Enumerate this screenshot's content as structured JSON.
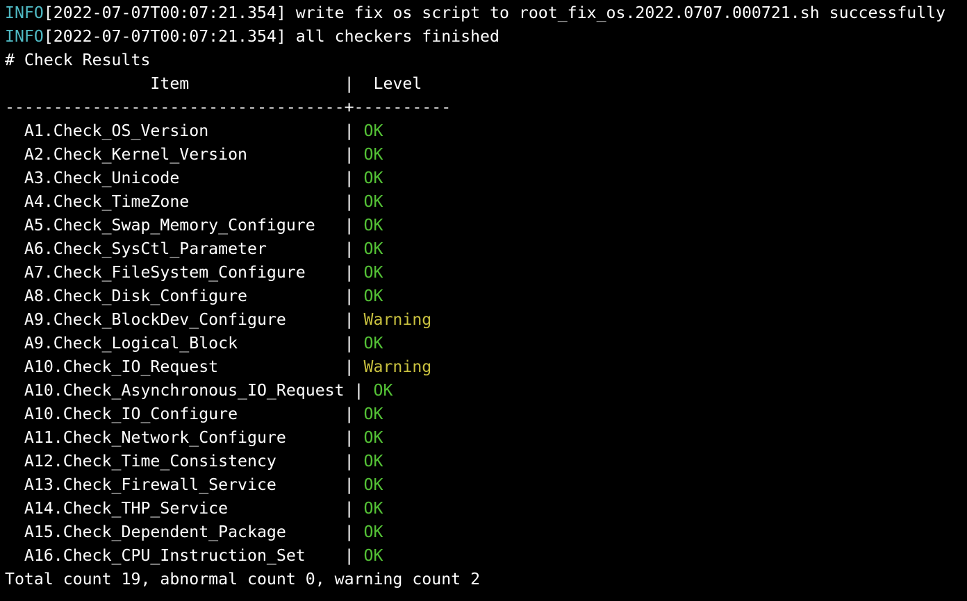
{
  "colors": {
    "background": "#000000",
    "text": "#ffffff",
    "info": "#4fb8c2",
    "ok": "#54c236",
    "warning": "#c9c13f"
  },
  "log": [
    {
      "level": "INFO",
      "text": "[2022-07-07T00:07:21.354] write fix os script to root_fix_os.2022.0707.000721.sh successfully"
    },
    {
      "level": "INFO",
      "text": "[2022-07-07T00:07:21.354] all checkers finished"
    }
  ],
  "results": {
    "heading": "# Check Results",
    "header_item": "               Item                |  Level",
    "separator": "-----------------------------------+----------",
    "rows": [
      {
        "item": "  A1.Check_OS_Version              | ",
        "level": "OK",
        "status": "ok"
      },
      {
        "item": "  A2.Check_Kernel_Version          | ",
        "level": "OK",
        "status": "ok"
      },
      {
        "item": "  A3.Check_Unicode                 | ",
        "level": "OK",
        "status": "ok"
      },
      {
        "item": "  A4.Check_TimeZone                | ",
        "level": "OK",
        "status": "ok"
      },
      {
        "item": "  A5.Check_Swap_Memory_Configure   | ",
        "level": "OK",
        "status": "ok"
      },
      {
        "item": "  A6.Check_SysCtl_Parameter        | ",
        "level": "OK",
        "status": "ok"
      },
      {
        "item": "  A7.Check_FileSystem_Configure    | ",
        "level": "OK",
        "status": "ok"
      },
      {
        "item": "  A8.Check_Disk_Configure          | ",
        "level": "OK",
        "status": "ok"
      },
      {
        "item": "  A9.Check_BlockDev_Configure      | ",
        "level": "Warning",
        "status": "warning"
      },
      {
        "item": "  A9.Check_Logical_Block           | ",
        "level": "OK",
        "status": "ok"
      },
      {
        "item": "  A10.Check_IO_Request             | ",
        "level": "Warning",
        "status": "warning"
      },
      {
        "item": "  A10.Check_Asynchronous_IO_Request | ",
        "level": "OK",
        "status": "ok"
      },
      {
        "item": "  A10.Check_IO_Configure           | ",
        "level": "OK",
        "status": "ok"
      },
      {
        "item": "  A11.Check_Network_Configure      | ",
        "level": "OK",
        "status": "ok"
      },
      {
        "item": "  A12.Check_Time_Consistency       | ",
        "level": "OK",
        "status": "ok"
      },
      {
        "item": "  A13.Check_Firewall_Service       | ",
        "level": "OK",
        "status": "ok"
      },
      {
        "item": "  A14.Check_THP_Service            | ",
        "level": "OK",
        "status": "ok"
      },
      {
        "item": "  A15.Check_Dependent_Package      | ",
        "level": "OK",
        "status": "ok"
      },
      {
        "item": "  A16.Check_CPU_Instruction_Set    | ",
        "level": "OK",
        "status": "ok"
      }
    ],
    "summary": "Total count 19, abnormal count 0, warning count 2"
  }
}
